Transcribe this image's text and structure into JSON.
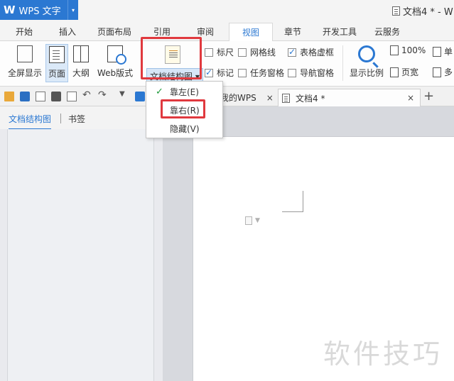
{
  "app": {
    "logo": "W",
    "name": "WPS 文字",
    "menu_arrow": "▾"
  },
  "window": {
    "title": "文档4 * - W"
  },
  "menu_tabs": [
    "开始",
    "插入",
    "页面布局",
    "引用",
    "审阅",
    "视图",
    "章节",
    "开发工具",
    "云服务"
  ],
  "active_menu_tab": "视图",
  "ribbon": {
    "fullscreen": "全屏显示",
    "page": "页面",
    "outline": "大纲",
    "web": "Web版式",
    "doc_map": "文档结构图",
    "doc_map_arrow": "▾",
    "ruler": "标尺",
    "gridlines": "网格线",
    "table_gridlines": "表格虚框",
    "marks": "标记",
    "task_pane": "任务窗格",
    "nav_pane": "导航窗格",
    "zoom_ratio": "显示比例",
    "zoom_100": "100%",
    "single_page": "单",
    "page_width": "页宽",
    "multi_page": "多"
  },
  "checkboxes": {
    "ruler": false,
    "gridlines": false,
    "table_gridlines": true,
    "marks": true,
    "task_pane": false,
    "nav_pane": false
  },
  "doc_tabs": [
    {
      "label": "我的WPS",
      "close": "×"
    },
    {
      "label": "文档4 *",
      "close": "×"
    }
  ],
  "tab_add": "+",
  "nav_panel": {
    "tab_map": "文档结构图",
    "tab_bookmark": "书签"
  },
  "dropdown": {
    "check": "✓",
    "items": [
      "靠左(E)",
      "靠右(R)",
      "隐藏(V)"
    ]
  },
  "watermark": "软件技巧",
  "colors": {
    "accent": "#2b78d2",
    "highlight": "#e0393e"
  }
}
